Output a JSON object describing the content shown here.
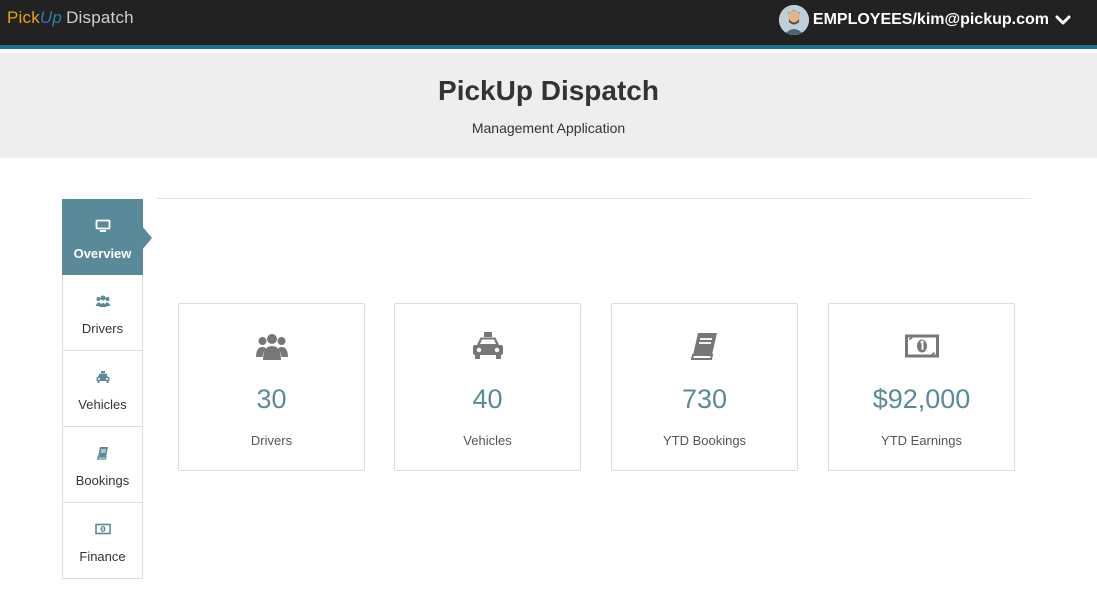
{
  "navbar": {
    "brand_pick": "Pick",
    "brand_up": "Up",
    "brand_dispatch": "Dispatch",
    "user_label": "EMPLOYEES/kim@pickup.com",
    "accent": "#1e6e8f"
  },
  "header": {
    "title": "PickUp Dispatch",
    "subtitle": "Management Application"
  },
  "sidebar": {
    "items": [
      {
        "label": "Overview",
        "icon": "monitor-icon",
        "active": true
      },
      {
        "label": "Drivers",
        "icon": "users-icon",
        "active": false
      },
      {
        "label": "Vehicles",
        "icon": "taxi-icon",
        "active": false
      },
      {
        "label": "Bookings",
        "icon": "book-icon",
        "active": false
      },
      {
        "label": "Finance",
        "icon": "money-icon",
        "active": false
      }
    ]
  },
  "stats": [
    {
      "value": "30",
      "label": "Drivers",
      "icon": "users-icon"
    },
    {
      "value": "40",
      "label": "Vehicles",
      "icon": "taxi-icon"
    },
    {
      "value": "730",
      "label": "YTD Bookings",
      "icon": "book-icon"
    },
    {
      "value": "$92,000",
      "label": "YTD Earnings",
      "icon": "money-icon"
    }
  ],
  "colors": {
    "active_tab": "#5a8a99",
    "stat_value": "#5a8a99"
  }
}
